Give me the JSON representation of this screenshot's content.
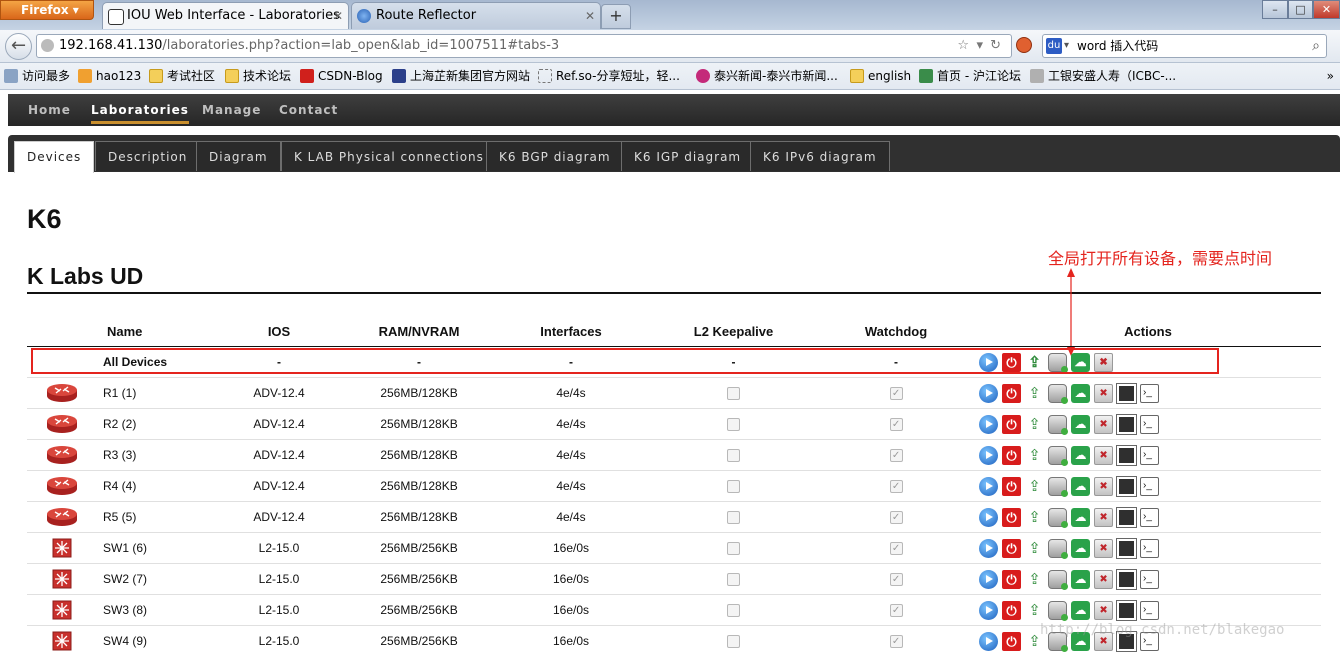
{
  "browser": {
    "firefox_label": "Firefox",
    "tabs": [
      {
        "label": "IOU Web Interface - Laboratories",
        "active": true
      },
      {
        "label": "Route Reflector",
        "active": false
      }
    ],
    "url_host": "192.168.41.130",
    "url_path": "/laboratories.php?action=lab_open&lab_id=1007511#tabs-3",
    "search_value": "word 插入代码",
    "bookmarks": [
      {
        "label": "访问最多",
        "icon": "gear-icon"
      },
      {
        "label": "hao123",
        "icon": "hao123-icon"
      },
      {
        "label": "考试社区",
        "icon": "folder-icon"
      },
      {
        "label": "技术论坛",
        "icon": "folder-icon"
      },
      {
        "label": "CSDN-Blog",
        "icon": "csdn-icon"
      },
      {
        "label": "上海芷新集团官方网站",
        "icon": "site-icon"
      },
      {
        "label": "Ref.so-分享短址，轻...",
        "icon": "page-icon"
      },
      {
        "label": "泰兴新闻-泰兴市新闻...",
        "icon": "site-icon"
      },
      {
        "label": "english",
        "icon": "folder-icon"
      },
      {
        "label": "首页 - 沪江论坛",
        "icon": "site-icon"
      },
      {
        "label": "工银安盛人寿（ICBC-...",
        "icon": "site-icon"
      }
    ],
    "bookmarks_more": "»"
  },
  "nav": {
    "items": [
      {
        "label": "Home",
        "active": false
      },
      {
        "label": "Laboratories",
        "active": true
      },
      {
        "label": "Manage",
        "active": false
      },
      {
        "label": "Contact",
        "active": false
      }
    ]
  },
  "lab_tabs": [
    {
      "label": "Devices",
      "active": true
    },
    {
      "label": "Description",
      "active": false
    },
    {
      "label": "Diagram",
      "active": false
    },
    {
      "label": "K LAB Physical connections",
      "active": false
    },
    {
      "label": "K6 BGP diagram",
      "active": false
    },
    {
      "label": "K6 IGP diagram",
      "active": false
    },
    {
      "label": "K6 IPv6 diagram",
      "active": false
    }
  ],
  "lab": {
    "title": "K6",
    "subtitle": "K Labs UD"
  },
  "annotation": "全局打开所有设备，需要点时间",
  "table": {
    "headers": {
      "name": "Name",
      "ios": "IOS",
      "ram": "RAM/NVRAM",
      "interfaces": "Interfaces",
      "l2keepalive": "L2 Keepalive",
      "watchdog": "Watchdog",
      "actions": "Actions"
    },
    "all_row": {
      "name": "All Devices",
      "ios": "-",
      "ram": "-",
      "interfaces": "-",
      "l2keepalive": "-",
      "watchdog": "-"
    },
    "rows": [
      {
        "type": "router",
        "name": "R1 (1)",
        "ios": "ADV-12.4",
        "ram": "256MB/128KB",
        "interfaces": "4e/4s",
        "l2keepalive": false,
        "watchdog": true
      },
      {
        "type": "router",
        "name": "R2 (2)",
        "ios": "ADV-12.4",
        "ram": "256MB/128KB",
        "interfaces": "4e/4s",
        "l2keepalive": false,
        "watchdog": true
      },
      {
        "type": "router",
        "name": "R3 (3)",
        "ios": "ADV-12.4",
        "ram": "256MB/128KB",
        "interfaces": "4e/4s",
        "l2keepalive": false,
        "watchdog": true
      },
      {
        "type": "router",
        "name": "R4 (4)",
        "ios": "ADV-12.4",
        "ram": "256MB/128KB",
        "interfaces": "4e/4s",
        "l2keepalive": false,
        "watchdog": true
      },
      {
        "type": "router",
        "name": "R5 (5)",
        "ios": "ADV-12.4",
        "ram": "256MB/128KB",
        "interfaces": "4e/4s",
        "l2keepalive": false,
        "watchdog": true
      },
      {
        "type": "switch",
        "name": "SW1 (6)",
        "ios": "L2-15.0",
        "ram": "256MB/256KB",
        "interfaces": "16e/0s",
        "l2keepalive": false,
        "watchdog": true
      },
      {
        "type": "switch",
        "name": "SW2 (7)",
        "ios": "L2-15.0",
        "ram": "256MB/256KB",
        "interfaces": "16e/0s",
        "l2keepalive": false,
        "watchdog": true
      },
      {
        "type": "switch",
        "name": "SW3 (8)",
        "ios": "L2-15.0",
        "ram": "256MB/256KB",
        "interfaces": "16e/0s",
        "l2keepalive": false,
        "watchdog": true
      },
      {
        "type": "switch",
        "name": "SW4 (9)",
        "ios": "L2-15.0",
        "ram": "256MB/256KB",
        "interfaces": "16e/0s",
        "l2keepalive": false,
        "watchdog": true
      }
    ],
    "all_actions": [
      "play-icon",
      "stop-icon",
      "wipe-icon",
      "export-config-icon",
      "cloud-icon",
      "delete-icon"
    ],
    "device_actions": [
      "play-icon",
      "stop-icon",
      "wipe-icon",
      "export-config-icon",
      "cloud-icon",
      "delete-icon",
      "netmap-icon",
      "console-icon"
    ]
  },
  "watermark": "http://blog.csdn.net/blakegao",
  "colors": {
    "annotation_red": "#e4241e",
    "menu_bg": "#262626",
    "active_menu_underline": "#c98f2e"
  }
}
